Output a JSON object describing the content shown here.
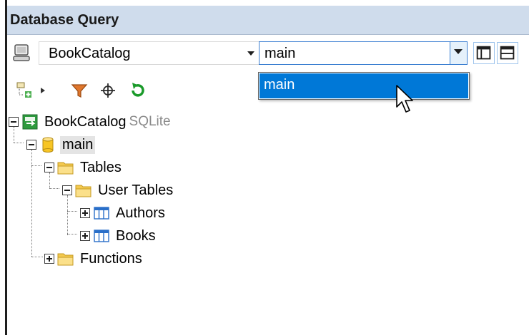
{
  "panel": {
    "title": "Database Query"
  },
  "connection": {
    "selected": "BookCatalog"
  },
  "schema": {
    "selected": "main",
    "options": [
      "main"
    ]
  },
  "icons": {
    "connection": "database-connection-icon",
    "add_object": "add-object-icon",
    "filter": "filter-icon",
    "locate": "crosshair-icon",
    "refresh": "refresh-icon",
    "layout1": "layout-panel-icon",
    "layout2": "layout-split-icon"
  },
  "colors": {
    "title_bar": "#cfdcec",
    "selection": "#0078d7",
    "refresh": "#1a9a2a",
    "filter": "#c8641e"
  },
  "tree": {
    "root": {
      "label": "BookCatalog",
      "type": "SQLite"
    },
    "schema": {
      "label": "main"
    },
    "tables": {
      "label": "Tables"
    },
    "user_tables": {
      "label": "User Tables"
    },
    "authors": {
      "label": "Authors"
    },
    "books": {
      "label": "Books"
    },
    "functions": {
      "label": "Functions"
    }
  }
}
